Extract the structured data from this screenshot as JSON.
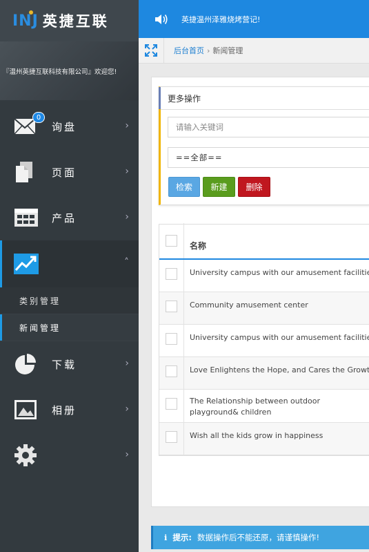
{
  "brand": {
    "mark": "INJ",
    "name": "英捷互联"
  },
  "user": {
    "welcome": "『温州英捷互联科技有限公司』欢迎您!"
  },
  "notice": {
    "text": "英捷温州泽雅烧烤营记!"
  },
  "breadcrumb": {
    "home": "后台首页",
    "separator": "›",
    "current": "新闻管理"
  },
  "sidebar": {
    "items": [
      {
        "label": "询盘",
        "icon": "mail-icon",
        "badge": "0"
      },
      {
        "label": "页面",
        "icon": "document-icon"
      },
      {
        "label": "产品",
        "icon": "grid-icon"
      },
      {
        "label": "",
        "icon": "chart-icon",
        "expanded": true
      },
      {
        "label": "下载",
        "icon": "pie-icon"
      },
      {
        "label": "相册",
        "icon": "image-icon"
      },
      {
        "label": "",
        "icon": "gear-icon"
      }
    ],
    "submenu": [
      {
        "label": "类别管理"
      },
      {
        "label": "新闻管理",
        "current": true
      }
    ]
  },
  "operations": {
    "title": "更多操作",
    "keyword_placeholder": "请输入关键词",
    "category_value": "==全部==",
    "search_label": "检索",
    "new_label": "新建",
    "delete_label": "删除"
  },
  "table": {
    "header": "名称",
    "rows": [
      "University campus with our amusement facilities",
      "Community amusement center",
      "University campus with our amusement facilities",
      "Love Enlightens the Hope, and Cares the Growth",
      "The Relationship between outdoor playground& children",
      "Wish all the kids grow in happiness"
    ]
  },
  "tip": {
    "icon": "i",
    "label": "提示:",
    "text": "数据操作后不能还原，请谨慎操作!"
  },
  "colors": {
    "accent": "#1e88e0",
    "sidebar": "#333a3f",
    "success": "#5a9c1e",
    "danger": "#c0171f",
    "warning": "#f0b400"
  }
}
